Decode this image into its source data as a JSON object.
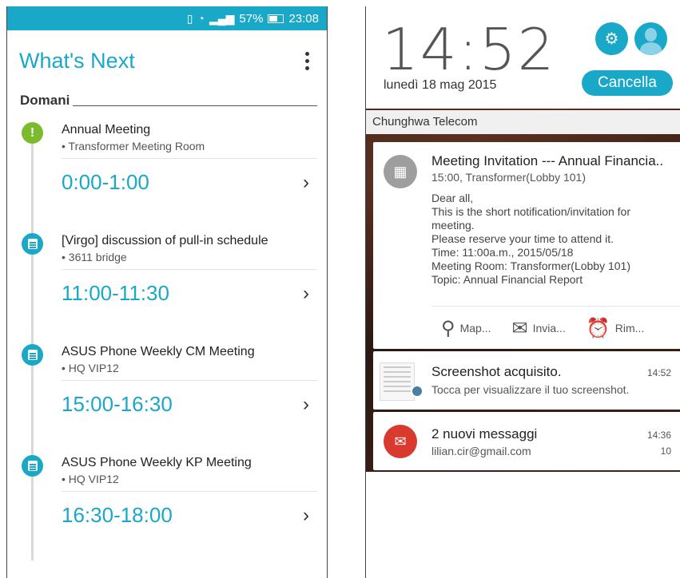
{
  "left_screen": {
    "status_bar": {
      "battery": "57%",
      "time": "23:08"
    },
    "title": "What's Next",
    "section": "Domani",
    "events": [
      {
        "title": "Annual Meeting",
        "location": "• Transformer Meeting Room",
        "time": "0:00-1:00",
        "icon": "alert-icon",
        "color": "#7dbb2e"
      },
      {
        "title": "[Virgo] discussion of pull-in schedule",
        "location": "• 3611 bridge",
        "time": "11:00-11:30",
        "icon": "calendar-icon",
        "color": "#1aa8c8"
      },
      {
        "title": "ASUS Phone Weekly CM Meeting",
        "location": "• HQ VIP12",
        "time": "15:00-16:30",
        "icon": "calendar-icon",
        "color": "#1aa8c8"
      },
      {
        "title": "ASUS Phone Weekly KP Meeting",
        "location": "• HQ VIP12",
        "time": "16:30-18:00",
        "icon": "calendar-icon",
        "color": "#1aa8c8"
      }
    ]
  },
  "right_screen": {
    "clock": "14:52",
    "date": "lunedì 18 mag 2015",
    "clear_label": "Cancella",
    "carrier": "Chunghwa Telecom",
    "accent_color": "#1aa8c8",
    "notifications": {
      "meeting": {
        "title": "Meeting Invitation --- Annual Financia..",
        "subtitle": "15:00, Transformer(Lobby 101)",
        "body": [
          "Dear all,",
          "This is the short notification/invitation for",
          "meeting.",
          "Please reserve your time to attend it.",
          "Time: 11:00a.m., 2015/05/18",
          "Meeting Room: Transformer(Lobby 101)",
          "Topic: Annual Financial Report"
        ],
        "actions": [
          {
            "label": "Map...",
            "icon": "map-pin-icon"
          },
          {
            "label": "Invia...",
            "icon": "envelope-icon"
          },
          {
            "label": "Rim...",
            "icon": "alarm-clock-icon"
          }
        ]
      },
      "screenshot": {
        "title": "Screenshot acquisito.",
        "subtitle": "Tocca per visualizzare il tuo screenshot.",
        "time": "14:52"
      },
      "gmail": {
        "title": "2 nuovi messaggi",
        "subtitle": "lilian.cir@gmail.com",
        "time": "14:36",
        "count": "10",
        "color": "#d93a2e"
      }
    }
  }
}
